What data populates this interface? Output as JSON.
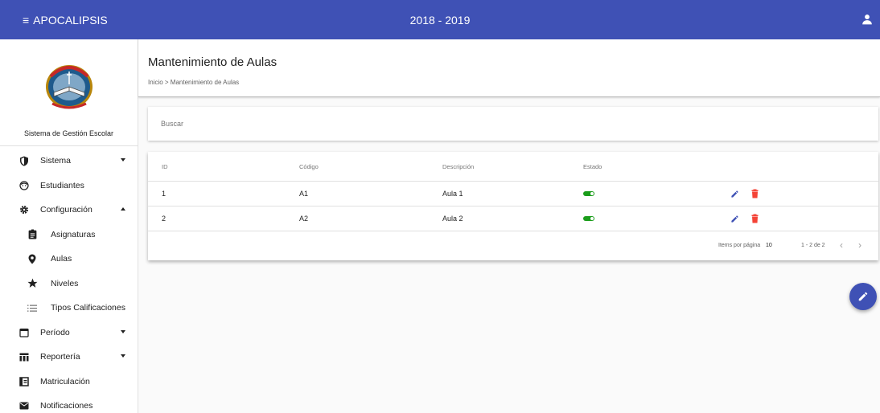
{
  "topbar": {
    "menu_icon": "menu-icon",
    "app_name": "APOCALIPSIS",
    "school_year": "2018 - 2019",
    "user_icon": "account-icon",
    "color": "#3f51b5"
  },
  "sidebar": {
    "logo_alt": "CENTRO EVANGÉLICO MISIONERO APOCALIPSIS",
    "system_name": "Sistema de Gestión Escolar",
    "items": [
      {
        "label": "Sistema",
        "icon": "shield-icon",
        "expandable": true,
        "expanded": false
      },
      {
        "label": "Estudiantes",
        "icon": "face-icon"
      },
      {
        "label": "Configuración",
        "icon": "gear-icon",
        "expandable": true,
        "expanded": true
      },
      {
        "label": "Asignaturas",
        "icon": "assignment-icon",
        "sub": true
      },
      {
        "label": "Aulas",
        "icon": "map-pin-icon",
        "sub": true
      },
      {
        "label": "Niveles",
        "icon": "star-icon",
        "sub": true
      },
      {
        "label": "Tipos Calificaciones",
        "icon": "list-icon",
        "sub": true
      },
      {
        "label": "Período",
        "icon": "calendar-icon",
        "expandable": true,
        "expanded": false
      },
      {
        "label": "Reportería",
        "icon": "table-icon",
        "expandable": true,
        "expanded": false
      },
      {
        "label": "Matriculación",
        "icon": "registration-icon"
      },
      {
        "label": "Notificaciones",
        "icon": "mail-icon"
      }
    ]
  },
  "page": {
    "title": "Mantenimiento de Aulas",
    "breadcrumb": "Inicio > Mantenimiento de Aulas"
  },
  "search": {
    "placeholder": "Buscar",
    "value": ""
  },
  "table": {
    "columns": [
      "ID",
      "Código",
      "Descripción",
      "Estado"
    ],
    "rows": [
      {
        "id": "1",
        "code": "A1",
        "description": "Aula 1",
        "active": true
      },
      {
        "id": "2",
        "code": "A2",
        "description": "Aula 2",
        "active": true
      }
    ],
    "edit_icon": "pencil-icon",
    "delete_icon": "trash-icon",
    "colors": {
      "active": "#1b9d1b",
      "edit": "#3f51b5",
      "delete": "#f44336"
    }
  },
  "pagination": {
    "items_label": "Items por página",
    "page_size": "10",
    "range": "1 - 2 de 2",
    "prev": "‹",
    "next": "›"
  },
  "fab": {
    "icon": "pencil-icon",
    "color": "#3f51b5"
  }
}
